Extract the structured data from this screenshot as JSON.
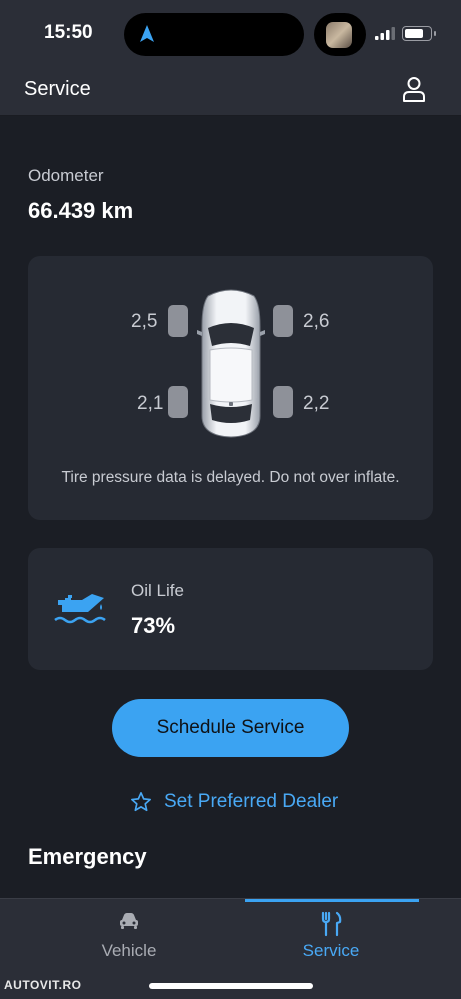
{
  "status_bar": {
    "time": "15:50"
  },
  "app_bar": {
    "title": "Service",
    "profile_icon": "person-icon"
  },
  "odometer": {
    "label": "Odometer",
    "value": "66.439 km"
  },
  "tires": {
    "front_left": "2,5",
    "front_right": "2,6",
    "rear_left": "2,1",
    "rear_right": "2,2",
    "note": "Tire pressure data is delayed. Do not over inflate."
  },
  "oil": {
    "label": "Oil Life",
    "value": "73%",
    "level_percent": 73,
    "icon": "oil-can-icon"
  },
  "actions": {
    "schedule_label": "Schedule Service",
    "dealer_label": "Set Preferred Dealer"
  },
  "emergency": {
    "title": "Emergency"
  },
  "tabs": [
    {
      "label": "Vehicle",
      "icon": "car-icon",
      "active": false
    },
    {
      "label": "Service",
      "icon": "tools-icon",
      "active": true
    }
  ],
  "watermark": "AUTOVIT.RO",
  "colors": {
    "accent": "#3ba3f2",
    "background": "#1b1e25",
    "card": "#262a33",
    "bar": "#2b2e37"
  }
}
